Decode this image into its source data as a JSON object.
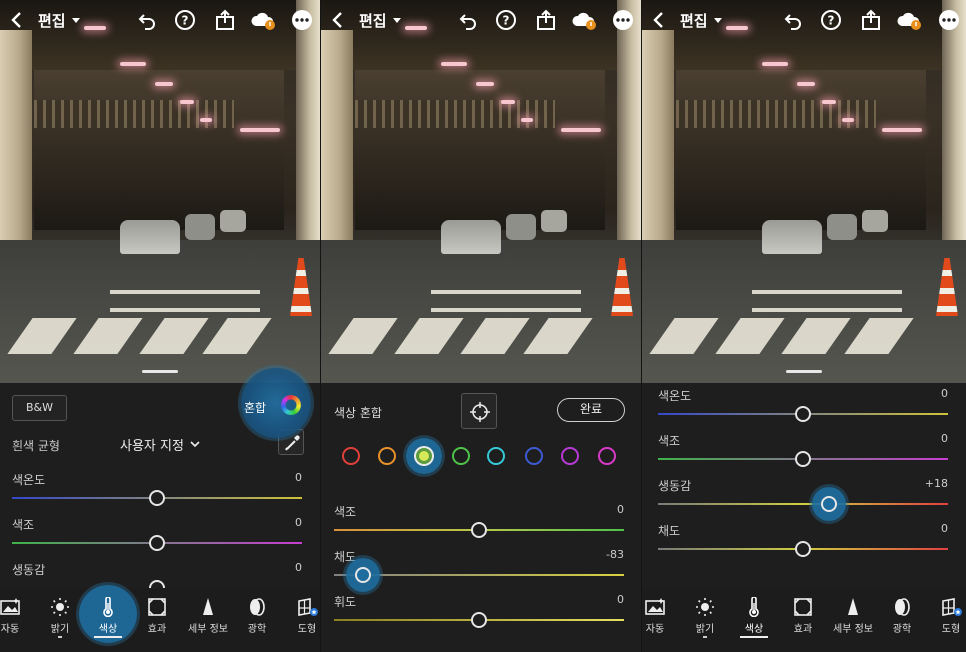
{
  "topbar": {
    "title": "편집"
  },
  "panel1": {
    "bw_label": "B&W",
    "mix_label": "혼합",
    "wb_label": "흰색 균형",
    "wb_value": "사용자 지정",
    "sliders": [
      {
        "label": "색온도",
        "value": "0",
        "pos": 0.5
      },
      {
        "label": "색조",
        "value": "0",
        "pos": 0.5
      },
      {
        "label": "생동감",
        "value": "0",
        "pos": 0.5
      }
    ]
  },
  "panel2": {
    "mix_title": "색상 혼합",
    "done_label": "완료",
    "swatch_colors": [
      "#e0403a",
      "#e8902c",
      "#d7e85b",
      "#4fc24a",
      "#35c8d8",
      "#3e5ad0",
      "#b73ad8",
      "#d83ac8"
    ],
    "selected_swatch": 2,
    "sliders": [
      {
        "label": "색조",
        "value": "0",
        "pos": 0.5
      },
      {
        "label": "채도",
        "value": "-83",
        "pos": 0.1
      },
      {
        "label": "휘도",
        "value": "0",
        "pos": 0.5
      }
    ]
  },
  "panel3": {
    "sliders": [
      {
        "label": "색온도",
        "value": "0",
        "pos": 0.5
      },
      {
        "label": "색조",
        "value": "0",
        "pos": 0.5
      },
      {
        "label": "생동감",
        "value": "+18",
        "pos": 0.59
      },
      {
        "label": "채도",
        "value": "0",
        "pos": 0.5
      }
    ]
  },
  "tools": [
    "자동",
    "밝기",
    "색상",
    "효과",
    "세부 정보",
    "광학",
    "도형"
  ],
  "colors": {
    "accent_halo": "#1e6ea0",
    "background": "#1e1e1e"
  }
}
